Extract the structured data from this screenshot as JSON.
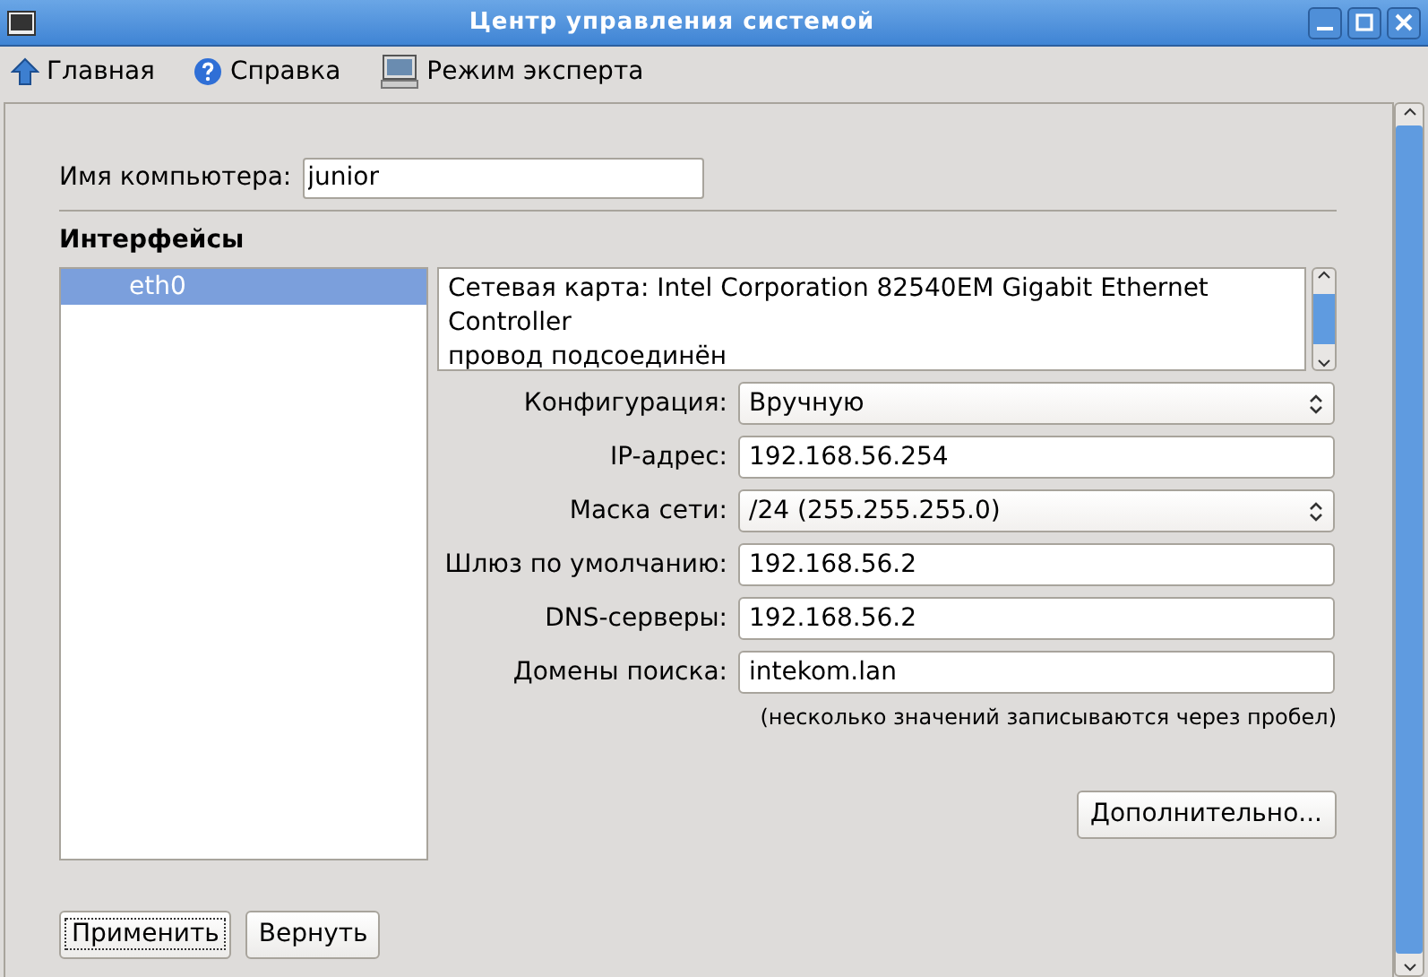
{
  "window": {
    "title": "Центр управления системой"
  },
  "toolbar": [
    {
      "kind": "home",
      "label": "Главная"
    },
    {
      "kind": "help",
      "label": "Справка"
    },
    {
      "kind": "expert",
      "label": "Режим эксперта"
    }
  ],
  "computer_name": {
    "label": "Имя компьютера:",
    "value": "junior"
  },
  "interfaces": {
    "title": "Интерфейсы",
    "items": [
      {
        "label": "eth0",
        "selected": true
      }
    ]
  },
  "description": [
    "Сетевая карта: Intel Corporation 82540EM Gigabit Ethernet Controller",
    "провод подсоединён"
  ],
  "fields": [
    {
      "kind": "select",
      "label": "Конфигурация:",
      "value": "Вручную"
    },
    {
      "kind": "text",
      "label": "IP-адрес:",
      "value": "192.168.56.254"
    },
    {
      "kind": "select",
      "label": "Маска сети:",
      "value": "/24 (255.255.255.0)"
    },
    {
      "kind": "text",
      "label": "Шлюз по умолчанию:",
      "value": "192.168.56.2"
    },
    {
      "kind": "text",
      "label": "DNS-серверы:",
      "value": "192.168.56.2"
    },
    {
      "kind": "text",
      "label": "Домены поиска:",
      "value": "intekom.lan"
    }
  ],
  "hint": "(несколько значений записываются через пробел)",
  "advanced_button": "Дополнительно...",
  "buttons": [
    {
      "label": "Применить",
      "focused": true
    },
    {
      "label": "Вернуть",
      "focused": false
    }
  ]
}
